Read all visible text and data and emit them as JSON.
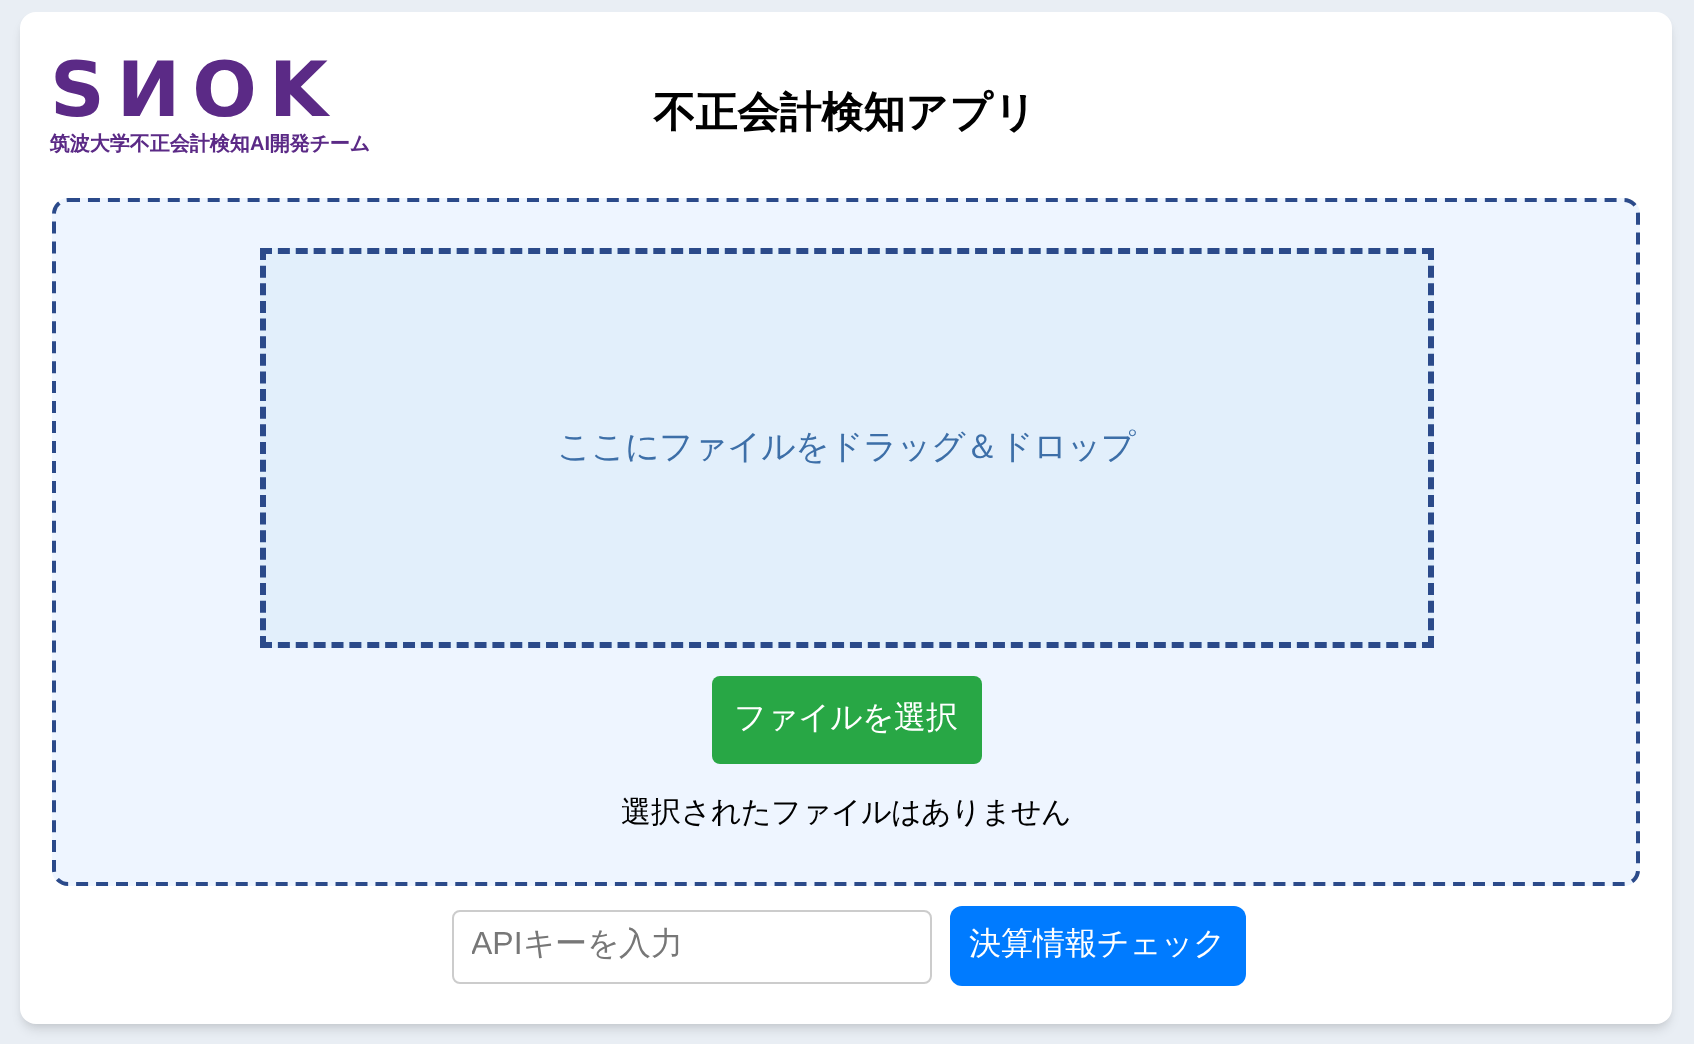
{
  "logo": {
    "text": "SИOK",
    "subtitle": "筑波大学不正会計検知AI開発チーム"
  },
  "title": "不正会計検知アプリ",
  "upload": {
    "drop_hint": "ここにファイルをドラッグ＆ドロップ",
    "select_button": "ファイルを選択",
    "status": "選択されたファイルはありません"
  },
  "api_key": {
    "placeholder": "APIキーを入力"
  },
  "check_button": "決算情報チェック"
}
